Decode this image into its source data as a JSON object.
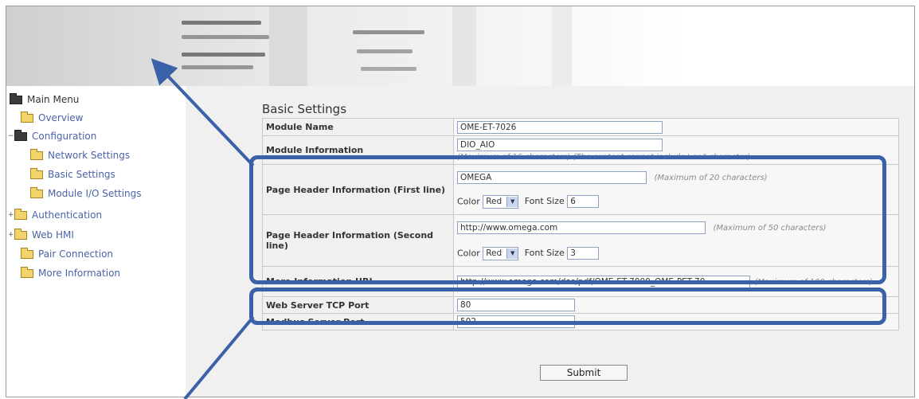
{
  "menu": {
    "items": [
      {
        "label": "Main Menu"
      },
      {
        "label": "Overview"
      },
      {
        "label": "Configuration"
      },
      {
        "label": "Network Settings"
      },
      {
        "label": "Basic Settings"
      },
      {
        "label": "Module I/O Settings"
      },
      {
        "label": "Authentication"
      },
      {
        "label": "Web HMI"
      },
      {
        "label": "Pair Connection"
      },
      {
        "label": "More Information"
      }
    ]
  },
  "main": {
    "title": "Basic Settings",
    "rows": {
      "module_name": {
        "label": "Module Name",
        "value": "OME-ET-7026"
      },
      "module_info": {
        "label": "Module Information",
        "value": "DIO_AIO",
        "hint": "(Maximum of 16 characters) (The content cannot include ' or \" character)"
      },
      "header_first": {
        "label": "Page Header Information (First line)",
        "value": "OMEGA",
        "hint": "(Maximum of 20 characters)",
        "color_label": "Color",
        "color": "Red",
        "font_size_label": "Font Size",
        "font_size": "6"
      },
      "header_second": {
        "label": "Page Header Information (Second line)",
        "value": "http://www.omega.com",
        "hint": "(Maximum of 50 characters)",
        "color_label": "Color",
        "color": "Red",
        "font_size_label": "Font Size",
        "font_size": "3"
      },
      "more_info_url": {
        "label": "More Information URL",
        "value": "http://www.omega.com/das/pdf/OME-ET-7000_OME-PET-70",
        "hint": "(Maximum of 100 characters)"
      },
      "web_port": {
        "label": "Web Server TCP Port",
        "value": "80"
      },
      "modbus_port": {
        "label": "Modbus Server Port",
        "value": "502"
      }
    },
    "submit_label": "Submit"
  },
  "annotations": {
    "highlight_color": "#3b61a8"
  }
}
